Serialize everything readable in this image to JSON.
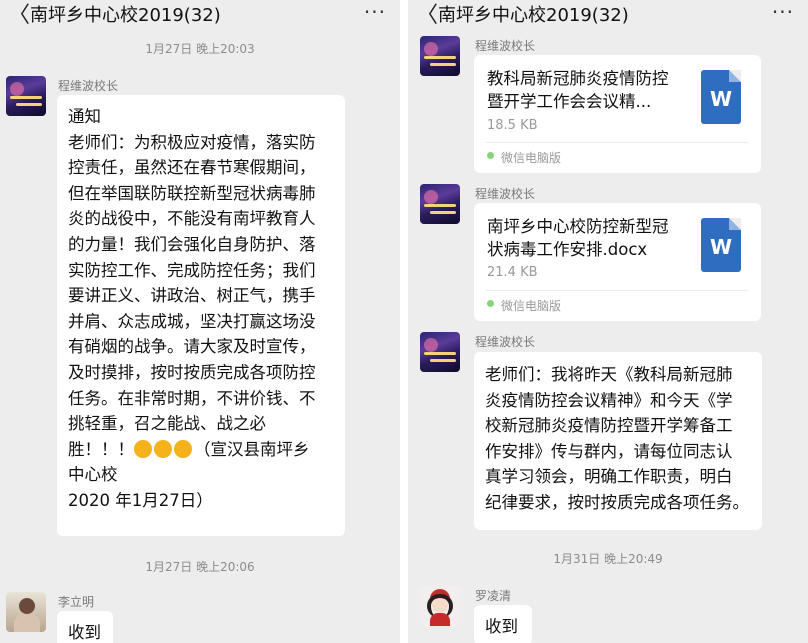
{
  "left": {
    "back_glyph": "〈",
    "title": "南坪乡中心校2019(32)",
    "more_glyph": "···",
    "timestamp_1": "1月27日 晚上20:03",
    "msg1": {
      "sender": "程维波校长",
      "line_1": "通知",
      "line_2": "老师们：为积极应对疫情，落实防",
      "line_3": "控责任，虽然还在春节寒假期间，",
      "line_4": "但在举国联防联控新型冠状病毒肺",
      "line_5": "炎的战役中，不能没有南坪教育人",
      "line_6": "的力量！我们会强化自身防护、落",
      "line_7": "实防控工作、完成防控任务；我们",
      "line_8": "要讲正义、讲政治、树正气，携手",
      "line_9": "并肩、众志成城，坚决打赢这场没",
      "line_10": "有硝烟的战争。请大家及时宣传，",
      "line_11": "及时摸排，按时按质完成各项防控",
      "line_12": "任务。在非常时期，不讲价钱、不",
      "line_13": "挑轻重，召之能战、战之必",
      "line_14_a": "胜！！！",
      "line_14_b": "（宣汉县南坪乡",
      "line_15": "中心校",
      "line_16": "2020 年1月27日）"
    },
    "timestamp_2": "1月27日 晚上20:06",
    "msg2": {
      "sender": "李立明",
      "text": "收到"
    }
  },
  "right": {
    "back_glyph": "〈",
    "title": "南坪乡中心校2019(32)",
    "more_glyph": "···",
    "file1": {
      "sender": "程维波校长",
      "name_line_1": "教科局新冠肺炎疫情防控",
      "name_line_2": "暨开学工作会会议精...",
      "size": "18.5 KB",
      "icon_letter": "W",
      "source": "微信电脑版"
    },
    "file2": {
      "sender": "程维波校长",
      "name_line_1": "南坪乡中心校防控新型冠",
      "name_line_2": "状病毒工作安排.docx",
      "size": "21.4 KB",
      "icon_letter": "W",
      "source": "微信电脑版"
    },
    "msg3": {
      "sender": "程维波校长",
      "line_1": "老师们：我将昨天《教科局新冠肺",
      "line_2": "炎疫情防控会议精神》和今天《学",
      "line_3": "校新冠肺炎疫情防控暨开学筹备工",
      "line_4": "作安排》传与群内，请每位同志认",
      "line_5": "真学习领会，明确工作职责，明白",
      "line_6": "纪律要求，按时按质完成各项任务。"
    },
    "timestamp": "1月31日 晚上20:49",
    "msg4": {
      "sender": "罗凌清",
      "text": "收到"
    }
  },
  "colors": {
    "background": "#ededed",
    "bubble": "#ffffff",
    "word_icon": "#2f6dc0"
  },
  "icons": {
    "back": "chevron-left-icon",
    "more": "more-dots-icon",
    "file": "word-doc-icon",
    "source": "wechat-pc-icon",
    "fist": "fist-emoji-icon"
  }
}
